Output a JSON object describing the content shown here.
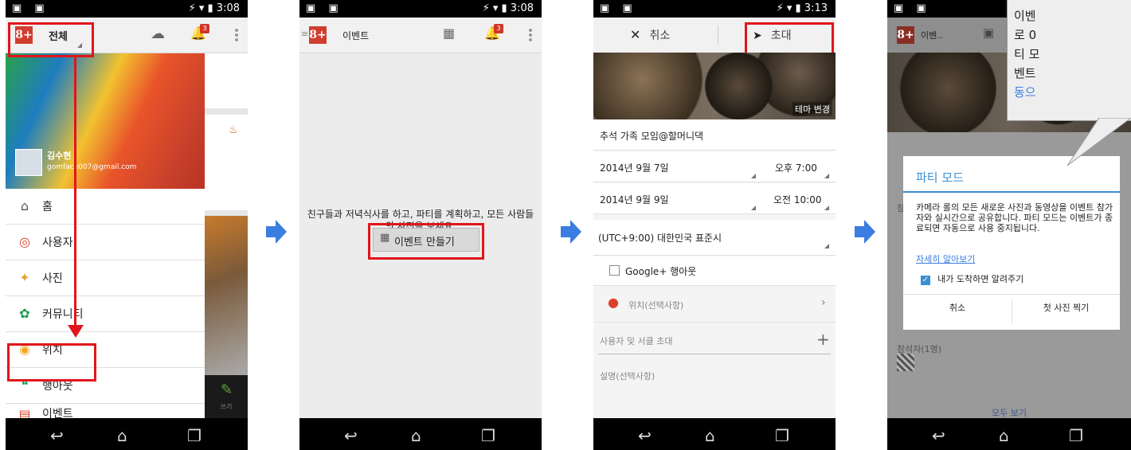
{
  "p1": {
    "time": "3:08",
    "menu_label": "전체",
    "badge": "3",
    "user": {
      "name": "김수현",
      "email": "gomface007@gmail.com"
    },
    "nav": [
      "홈",
      "사용자",
      "사진",
      "커뮤니티",
      "위치",
      "행아웃",
      "이벤트"
    ],
    "write_label": "쓰기"
  },
  "p2": {
    "time": "3:08",
    "title": "이벤트",
    "badge": "3",
    "message": "친구들과 저녁식사를 하고, 파티를 계획하고, 모든 사람들의 사진을 보세요.",
    "create_button": "이벤트 만들기"
  },
  "p3": {
    "time": "3:13",
    "cancel": "취소",
    "invite": "초대",
    "theme_change": "테마 변경",
    "event_name": "추석 가족 모임@할머니댁",
    "start_date": "2014년 9월 7일",
    "start_time": "오후 7:00",
    "end_date": "2014년 9월 9일",
    "end_time": "오전 10:00",
    "timezone": "(UTC+9:00) 대한민국 표준시",
    "hangout_checkbox": "Google+ 행아웃",
    "location_placeholder": "위치(선택사항)",
    "invite_placeholder": "사용자 및 서클 초대",
    "description_placeholder": "설명(선택사항)"
  },
  "p4": {
    "title": "이벤..",
    "tooltip": [
      "이벤",
      "로 0",
      "티 모",
      "벤트"
    ],
    "tooltip_link": "동으",
    "dialog_title": "파티 모드",
    "dialog_body": "카메라 롤의 모든 새로운 사진과 동영상을 이벤트 참가자와 실시간으로 공유합니다. 파티 모드는 이벤트가 종료되면 자동으로 사용 중지됩니다.",
    "learn_more": "자세히 알아보기",
    "notify_checkbox": "내가 도착하면 알려주기",
    "cancel_button": "취소",
    "first_photo_button": "첫 사진 찍기",
    "attendees": "참석자(1명)",
    "see_all": "모두 보기",
    "left_fragment": "참"
  },
  "colors": {
    "accent": "#3b7de0",
    "red": "#e2151c",
    "gplus": "#d13d2f"
  }
}
